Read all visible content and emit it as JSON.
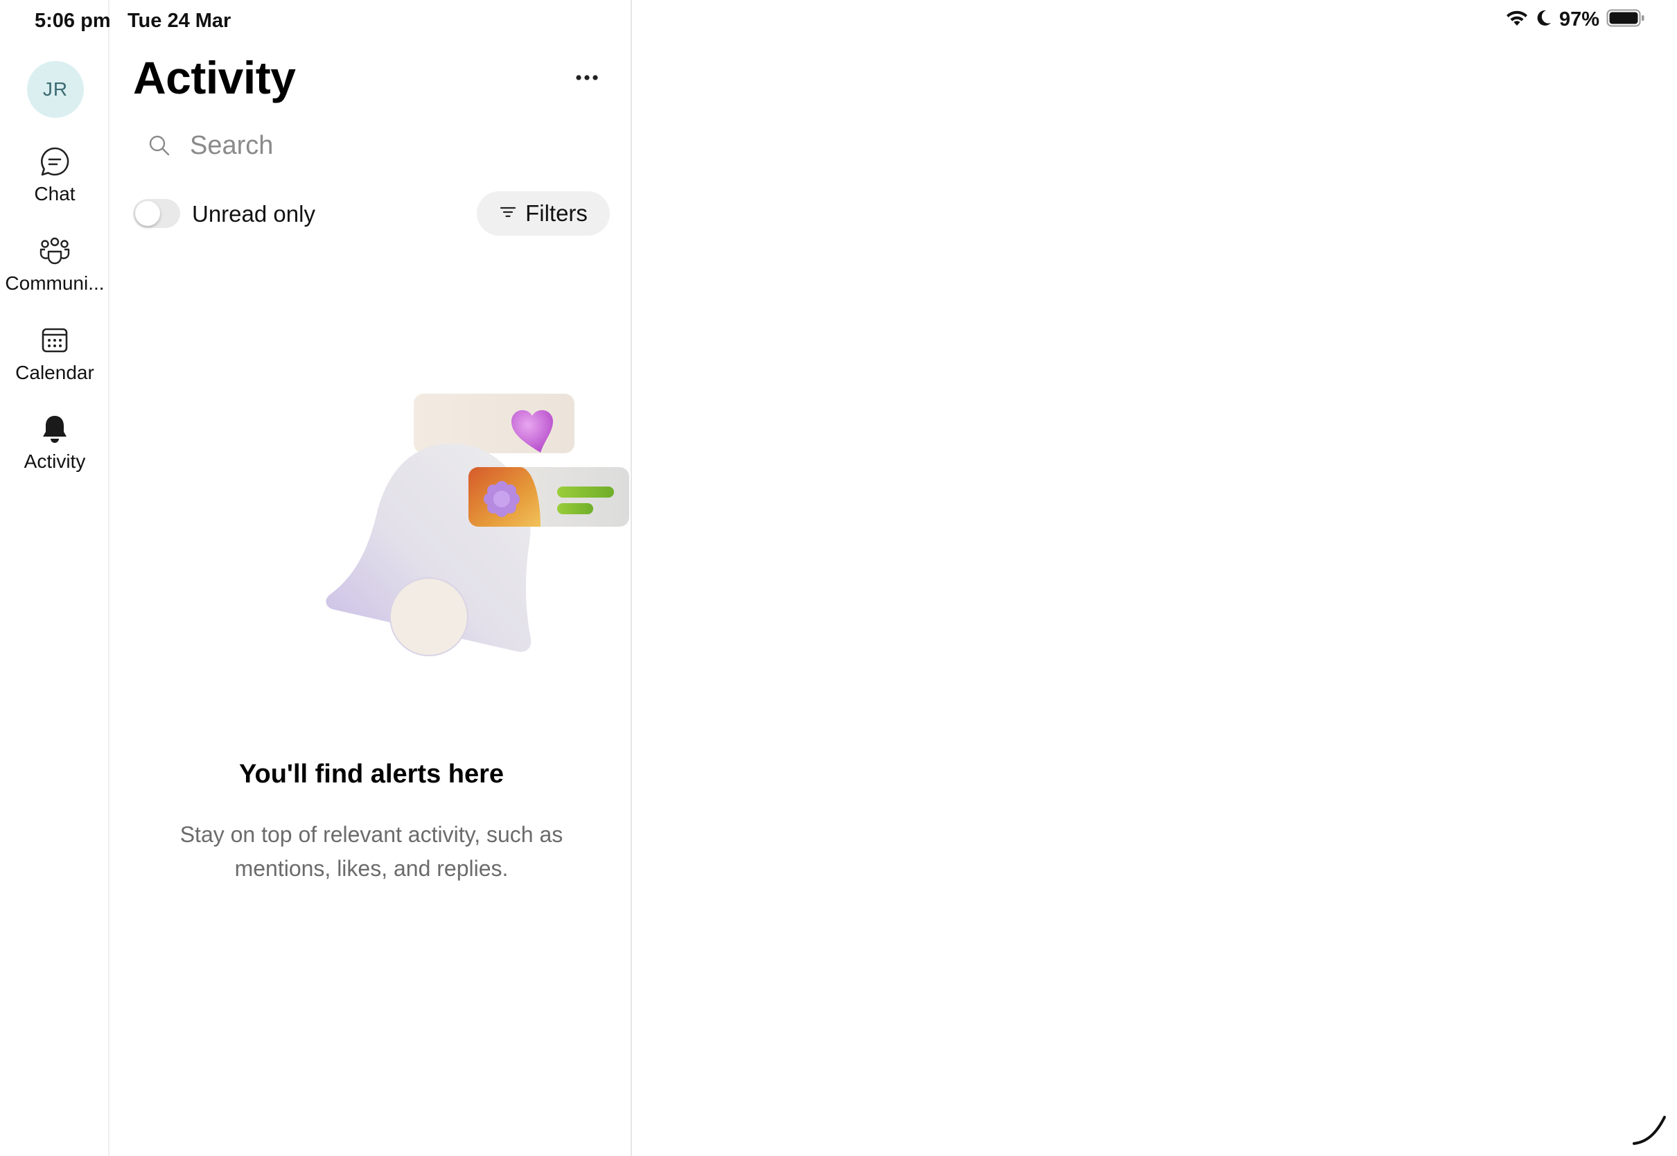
{
  "status_bar": {
    "time": "5:06 pm",
    "date": "Tue 24 Mar",
    "battery_percent": "97%",
    "icons": [
      "wifi-icon",
      "moon-icon",
      "battery-icon"
    ]
  },
  "rail": {
    "avatar_initials": "JR",
    "items": [
      {
        "label": "Chat",
        "icon": "chat-icon"
      },
      {
        "label": "Communi...",
        "icon": "communities-icon"
      },
      {
        "label": "Calendar",
        "icon": "calendar-icon"
      },
      {
        "label": "Activity",
        "icon": "bell-icon",
        "selected": true
      }
    ]
  },
  "pane": {
    "title": "Activity",
    "more_icon": "more-horizontal-icon",
    "search": {
      "placeholder": "Search",
      "value": ""
    },
    "unread_toggle": {
      "label": "Unread only",
      "on": false
    },
    "filters_label": "Filters",
    "empty_state": {
      "title": "You'll find alerts here",
      "description": "Stay on top of relevant activity, such as mentions, likes, and replies."
    }
  },
  "colors": {
    "accent_avatar_bg": "#dbeff0",
    "toggle_off": "#e9e9ea",
    "filters_bg": "#f0f0f0",
    "secondary_text": "#6b6b6b"
  }
}
